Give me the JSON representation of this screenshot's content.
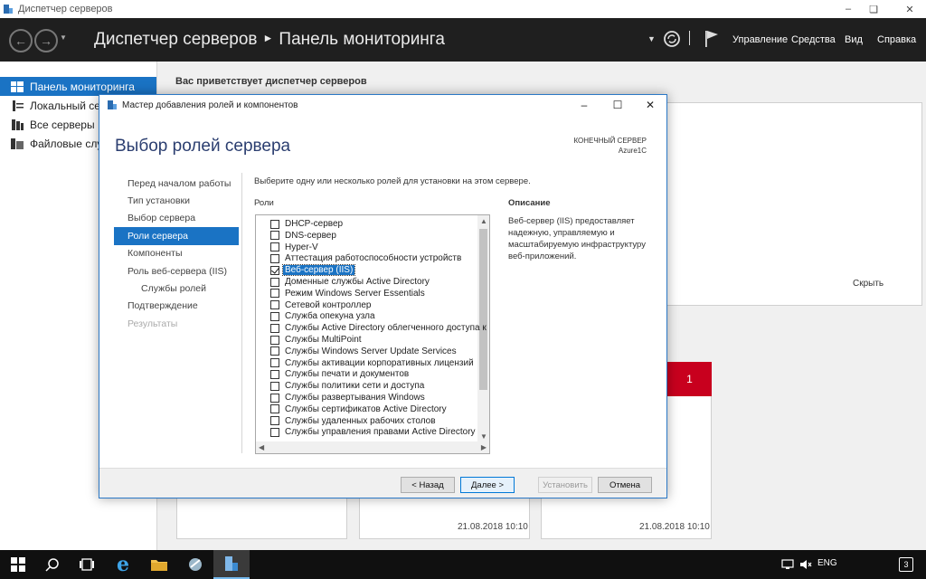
{
  "window": {
    "title": "Диспетчер серверов"
  },
  "header": {
    "breadcrumb_app": "Диспетчер серверов",
    "breadcrumb_page": "Панель мониторинга",
    "menu": [
      "Управление",
      "Средства",
      "Вид",
      "Справка"
    ]
  },
  "sidebar": {
    "items": [
      {
        "label": "Панель мониторинга",
        "active": true
      },
      {
        "label": "Локальный сервер",
        "active": false
      },
      {
        "label": "Все серверы",
        "active": false
      },
      {
        "label": "Файловые службы",
        "active": false
      }
    ]
  },
  "main": {
    "welcome": "Вас приветствует диспетчер серверов",
    "hide_label": "Скрыть",
    "tile_badge": "1",
    "tile_dates": [
      "21.08.2018 10:10",
      "21.08.2018 10:10"
    ]
  },
  "dialog": {
    "title": "Мастер добавления ролей и компонентов",
    "heading": "Выбор ролей сервера",
    "destination_label": "КОНЕЧНЫЙ СЕРВЕР",
    "destination_server": "Azure1C",
    "steps": [
      {
        "label": "Перед началом работы",
        "state": "normal",
        "sub": false
      },
      {
        "label": "Тип установки",
        "state": "normal",
        "sub": false
      },
      {
        "label": "Выбор сервера",
        "state": "normal",
        "sub": false
      },
      {
        "label": "Роли сервера",
        "state": "active",
        "sub": false
      },
      {
        "label": "Компоненты",
        "state": "normal",
        "sub": false
      },
      {
        "label": "Роль веб-сервера (IIS)",
        "state": "normal",
        "sub": false
      },
      {
        "label": "Службы ролей",
        "state": "normal",
        "sub": true
      },
      {
        "label": "Подтверждение",
        "state": "normal",
        "sub": false
      },
      {
        "label": "Результаты",
        "state": "disabled",
        "sub": false
      }
    ],
    "instruction": "Выберите одну или несколько ролей для установки на этом сервере.",
    "roles_header": "Роли",
    "description_header": "Описание",
    "description_text": "Веб-сервер (IIS) предоставляет надежную, управляемую и масштабируемую инфраструктуру веб-приложений.",
    "roles": [
      {
        "label": "DHCP-сервер",
        "checked": false,
        "selected": false
      },
      {
        "label": "DNS-сервер",
        "checked": false,
        "selected": false
      },
      {
        "label": "Hyper-V",
        "checked": false,
        "selected": false
      },
      {
        "label": "Аттестация работоспособности устройств",
        "checked": false,
        "selected": false
      },
      {
        "label": "Веб-сервер (IIS)",
        "checked": true,
        "selected": true
      },
      {
        "label": "Доменные службы Active Directory",
        "checked": false,
        "selected": false
      },
      {
        "label": "Режим Windows Server Essentials",
        "checked": false,
        "selected": false
      },
      {
        "label": "Сетевой контроллер",
        "checked": false,
        "selected": false
      },
      {
        "label": "Служба опекуна узла",
        "checked": false,
        "selected": false
      },
      {
        "label": "Службы Active Directory облегченного доступа к",
        "checked": false,
        "selected": false
      },
      {
        "label": "Службы MultiPoint",
        "checked": false,
        "selected": false
      },
      {
        "label": "Службы Windows Server Update Services",
        "checked": false,
        "selected": false
      },
      {
        "label": "Службы активации корпоративных лицензий",
        "checked": false,
        "selected": false
      },
      {
        "label": "Службы печати и документов",
        "checked": false,
        "selected": false
      },
      {
        "label": "Службы политики сети и доступа",
        "checked": false,
        "selected": false
      },
      {
        "label": "Службы развертывания Windows",
        "checked": false,
        "selected": false
      },
      {
        "label": "Службы сертификатов Active Directory",
        "checked": false,
        "selected": false
      },
      {
        "label": "Службы удаленных рабочих столов",
        "checked": false,
        "selected": false
      },
      {
        "label": "Службы управления правами Active Directory",
        "checked": false,
        "selected": false
      }
    ],
    "buttons": {
      "back": "< Назад",
      "next": "Далее >",
      "install": "Установить",
      "cancel": "Отмена"
    }
  },
  "taskbar": {
    "language": "ENG",
    "notifications": "3"
  }
}
